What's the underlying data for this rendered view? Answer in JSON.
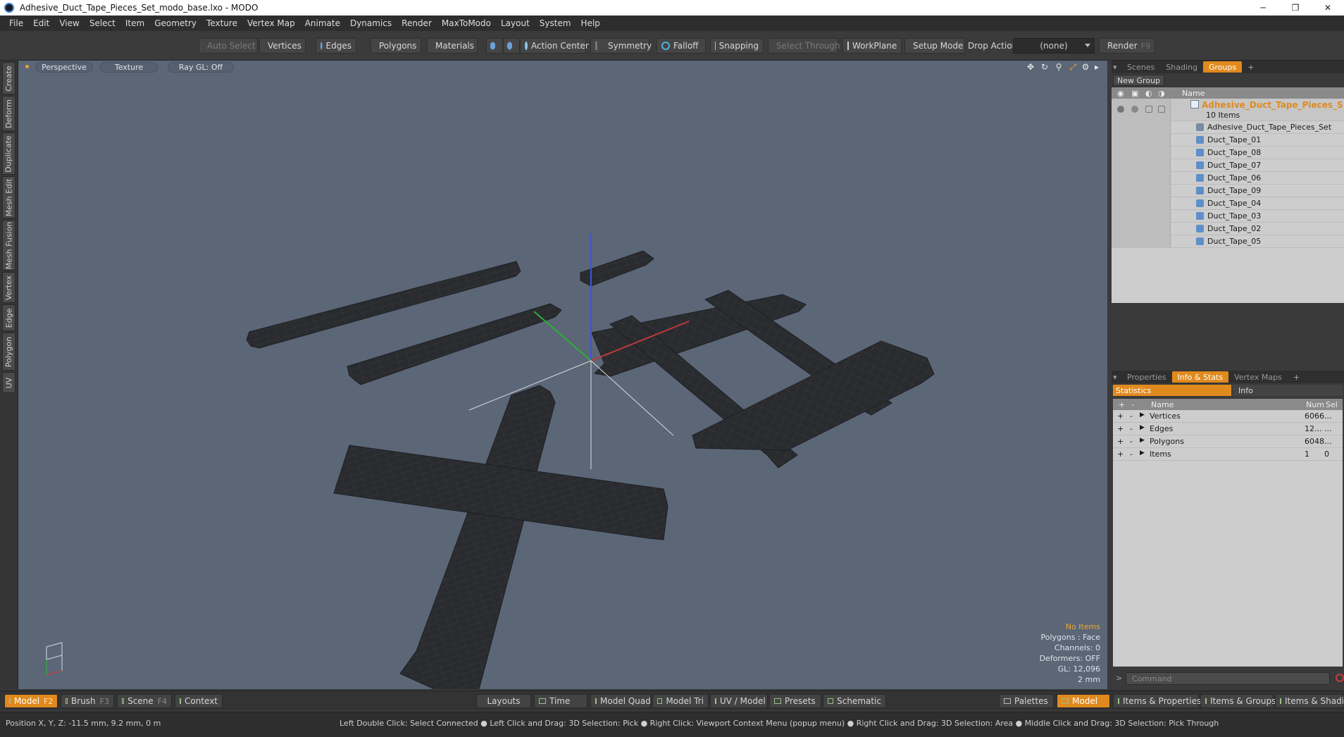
{
  "window": {
    "title": "Adhesive_Duct_Tape_Pieces_Set_modo_base.lxo - MODO",
    "controls": [
      "─",
      "❐",
      "✕"
    ]
  },
  "menu": [
    "File",
    "Edit",
    "View",
    "Select",
    "Item",
    "Geometry",
    "Texture",
    "Vertex Map",
    "Animate",
    "Dynamics",
    "Render",
    "MaxToModo",
    "Layout",
    "System",
    "Help"
  ],
  "toolbar": {
    "auto_select": "Auto Select",
    "vertices": "Vertices",
    "edges": "Edges",
    "polygons": "Polygons",
    "materials": "Materials",
    "action_center": "Action Center",
    "symmetry": "Symmetry",
    "falloff": "Falloff",
    "snapping": "Snapping",
    "select_through": "Select Through",
    "workplane": "WorkPlane",
    "setup_mode": "Setup Mode",
    "drop_action_label": "Drop Action",
    "drop_action_value": "(none)",
    "render": "Render",
    "render_key": "F9"
  },
  "left_tabs": [
    "Create",
    "Deform",
    "Duplicate",
    "Mesh Edit",
    "Mesh Fusion",
    "Vertex",
    "Edge",
    "Polygon",
    "UV"
  ],
  "viewport": {
    "view": "Perspective",
    "shading": "Texture",
    "raygl": "Ray GL: Off",
    "info": {
      "selection": "No Items",
      "polygons": "Polygons : Face",
      "channels": "Channels: 0",
      "deformers": "Deformers: OFF",
      "gl": "GL: 12,096",
      "scale": "2 mm"
    }
  },
  "groups_panel": {
    "tabs": [
      "Scenes",
      "Shading",
      "Groups"
    ],
    "active_tab": "Groups",
    "new_group": "New Group",
    "name_header": "Name",
    "group_name": "Adhesive_Duct_Tape_Pieces_S ...",
    "group_count": "10 Items",
    "items": [
      "Adhesive_Duct_Tape_Pieces_Set",
      "Duct_Tape_01",
      "Duct_Tape_08",
      "Duct_Tape_07",
      "Duct_Tape_06",
      "Duct_Tape_09",
      "Duct_Tape_04",
      "Duct_Tape_03",
      "Duct_Tape_02",
      "Duct_Tape_05"
    ]
  },
  "stats_panel": {
    "tabs": [
      "Properties",
      "Info & Stats",
      "Vertex Maps"
    ],
    "active_tab": "Info & Stats",
    "sub_tabs": [
      "Statistics",
      "Info"
    ],
    "headers": {
      "name": "Name",
      "num": "Num",
      "sel": "Sel"
    },
    "rows": [
      {
        "name": "Vertices",
        "num": "6066",
        "sel": "..."
      },
      {
        "name": "Edges",
        "num": "12...",
        "sel": "..."
      },
      {
        "name": "Polygons",
        "num": "6048",
        "sel": "..."
      },
      {
        "name": "Items",
        "num": "1",
        "sel": "0"
      }
    ]
  },
  "command": {
    "placeholder": "Command"
  },
  "layout_bar": {
    "model": "Model",
    "model_key": "F2",
    "brush": "Brush",
    "brush_key": "F3",
    "scene": "Scene",
    "scene_key": "F4",
    "context": "Context",
    "layouts": "Layouts",
    "time": "Time",
    "model_quad": "Model Quad",
    "model_tri": "Model Tri",
    "uv_model": "UV / Model",
    "presets": "Presets",
    "schematic": "Schematic",
    "palettes": "Palettes",
    "model_right": "Model",
    "items_properties": "Items & Properties",
    "items_groups": "Items & Groups",
    "items_shading": "Items & Shading"
  },
  "status": {
    "position": "Position X, Y, Z:  -11.5 mm, 9.2 mm, 0 m",
    "hint": "Left Double Click: Select Connected ● Left Click and Drag: 3D Selection: Pick ● Right Click: Viewport Context Menu (popup menu) ● Right Click and Drag: 3D Selection: Area ● Middle Click and Drag: 3D Selection: Pick Through"
  },
  "colors": {
    "accent": "#e08a1e",
    "viewport_bg": "#5b6677",
    "tape": "#2a2b2f"
  }
}
